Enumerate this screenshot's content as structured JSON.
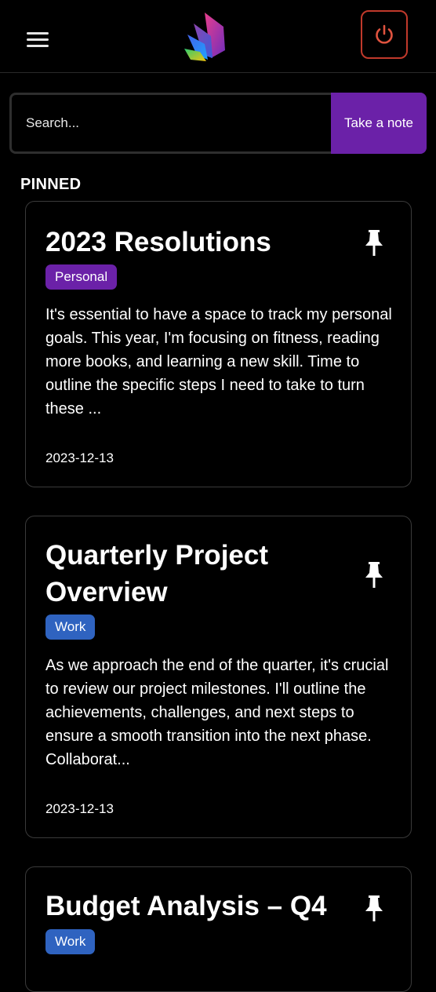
{
  "header": {
    "menu_icon": "hamburger-menu-icon",
    "logo_icon": "books-logo-icon",
    "power_icon": "power-icon",
    "power_color": "#c0392b"
  },
  "search": {
    "placeholder": "Search...",
    "value": "",
    "button_label": "Take a note",
    "button_color": "#6b21a8"
  },
  "section": {
    "label": "PINNED"
  },
  "notes": [
    {
      "title": "2023 Resolutions",
      "tag": "Personal",
      "tag_color": "#6b21a8",
      "body": "It's essential to have a space to track my personal goals. This year, I'm focusing on fitness, reading more books, and learning a new skill. Time to outline the specific steps I need to take to turn these ...",
      "date": "2023-12-13",
      "pinned": true,
      "pin_icon": "pushpin-icon"
    },
    {
      "title": "Quarterly Project Overview",
      "tag": "Work",
      "tag_color": "#2f63c0",
      "body": "As we approach the end of the quarter, it's crucial to review our project milestones. I'll outline the achievements, challenges, and next steps to ensure a smooth transition into the next phase. Collaborat...",
      "date": "2023-12-13",
      "pinned": true,
      "pin_icon": "pushpin-icon"
    },
    {
      "title": "Budget Analysis – Q4",
      "tag": "Work",
      "tag_color": "#2f63c0",
      "pinned": true,
      "pin_icon": "pushpin-icon"
    }
  ]
}
